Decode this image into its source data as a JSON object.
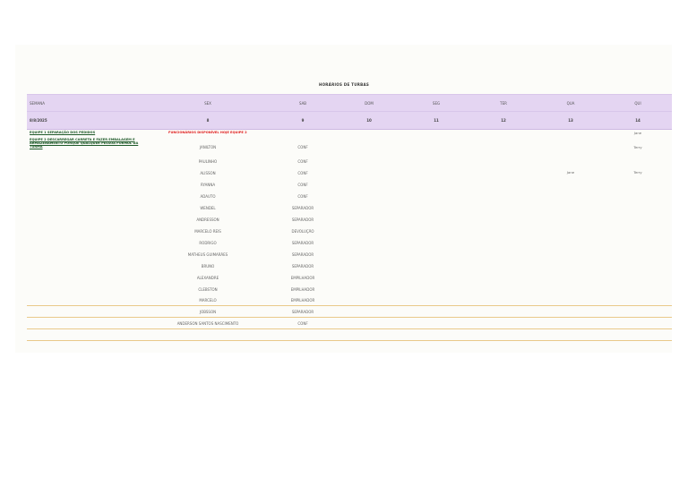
{
  "title": "HORÁRIOS DE TURBAS",
  "header_labels": {
    "semana": "SEMANA",
    "sex": "SEX",
    "sab": "SAB",
    "dom": "DOM",
    "seg": "SEG",
    "ter": "TER",
    "qua": "QUA",
    "qui": "QUI"
  },
  "date_row": {
    "date": "8/8/2025",
    "sex": "8",
    "sab": "9",
    "dom": "10",
    "seg": "11",
    "ter": "12",
    "qua": "13",
    "qui": "14"
  },
  "equipe_1": "EQUIPE 1 SEPARAÇÃO DOS PEDIDOS",
  "equipe_2": "EQUIPE 2 DESCARREGAR CARRETA E FAZER EMBALAGEM E ARMAZENAMENTO PORQUE QUALQUER PESSOA FORMUL DA TURMA",
  "funcionarios_label": "FUNCIONÁRIOS DISPONÍVEL HOJE EQUIPE 2",
  "qui_notes": {
    "jane_1": "Jane",
    "terry_1": "Terry",
    "jane_2": "Jane",
    "terry_2": "Terry"
  },
  "rows": [
    {
      "name": "JANILTON",
      "role": "CONF"
    },
    {
      "name": "PAULINHO",
      "role": "CONF"
    },
    {
      "name": "ALISSON",
      "role": "CONF"
    },
    {
      "name": "RYANNA",
      "role": "CONF"
    },
    {
      "name": "ADAUTO",
      "role": "CONF"
    },
    {
      "name": "WENDEL",
      "role": "SEPARADOR"
    },
    {
      "name": "ANDRESSON",
      "role": "SEPARADOR"
    },
    {
      "name": "MARCELO REIS",
      "role": "DEVOLUÇÃO"
    },
    {
      "name": "RODRIGO",
      "role": "SEPARADOR"
    },
    {
      "name": "MATHEUS GUIMARÃES",
      "role": "SEPARADOR"
    },
    {
      "name": "BRUNO",
      "role": "SEPARADOR"
    },
    {
      "name": "ALEXANDRE",
      "role": "EMPILHADOR"
    },
    {
      "name": "CLEBSTON",
      "role": "EMPILHADOR"
    },
    {
      "name": "MARCELO",
      "role": "EMPILHADOR"
    },
    {
      "name": "JOBSSON",
      "role": "SEPARADOR"
    },
    {
      "name": "ANDERSON SANTOS NASCIMENTO",
      "role": "CONF"
    }
  ]
}
